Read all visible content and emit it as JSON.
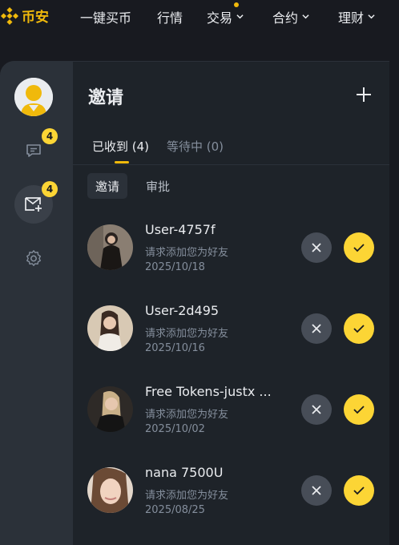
{
  "nav": {
    "brand": "币安",
    "items": [
      {
        "label": "一键买币",
        "has_menu": false
      },
      {
        "label": "行情",
        "has_menu": false
      },
      {
        "label": "交易",
        "has_menu": true
      },
      {
        "label": "合约",
        "has_menu": true
      },
      {
        "label": "理财",
        "has_menu": true
      }
    ]
  },
  "sidebar": {
    "chat_badge": "4",
    "invites_badge": "4",
    "icons": [
      "chat-icon",
      "mail-add-icon",
      "settings-icon"
    ]
  },
  "page": {
    "title": "邀请",
    "tabs": [
      {
        "label": "已收到 (4)",
        "active": true
      },
      {
        "label": "等待中 (0)",
        "active": false
      }
    ],
    "segments": [
      {
        "label": "邀请",
        "active": true
      },
      {
        "label": "审批",
        "active": false
      }
    ]
  },
  "invites": [
    {
      "name": "User-4757f",
      "message": "请求添加您为好友",
      "date": "2025/10/18"
    },
    {
      "name": "User-2d495",
      "message": "请求添加您为好友",
      "date": "2025/10/16"
    },
    {
      "name": "Free Tokens-justx ...",
      "message": "请求添加您为好友",
      "date": "2025/10/02"
    },
    {
      "name": "nana 7500U",
      "message": "请求添加您为好友",
      "date": "2025/08/25"
    }
  ],
  "colors": {
    "accent": "#fcd535",
    "brand": "#f0b90b",
    "background": "#181a20",
    "panel": "#1e2329",
    "rail": "#2b3139"
  }
}
